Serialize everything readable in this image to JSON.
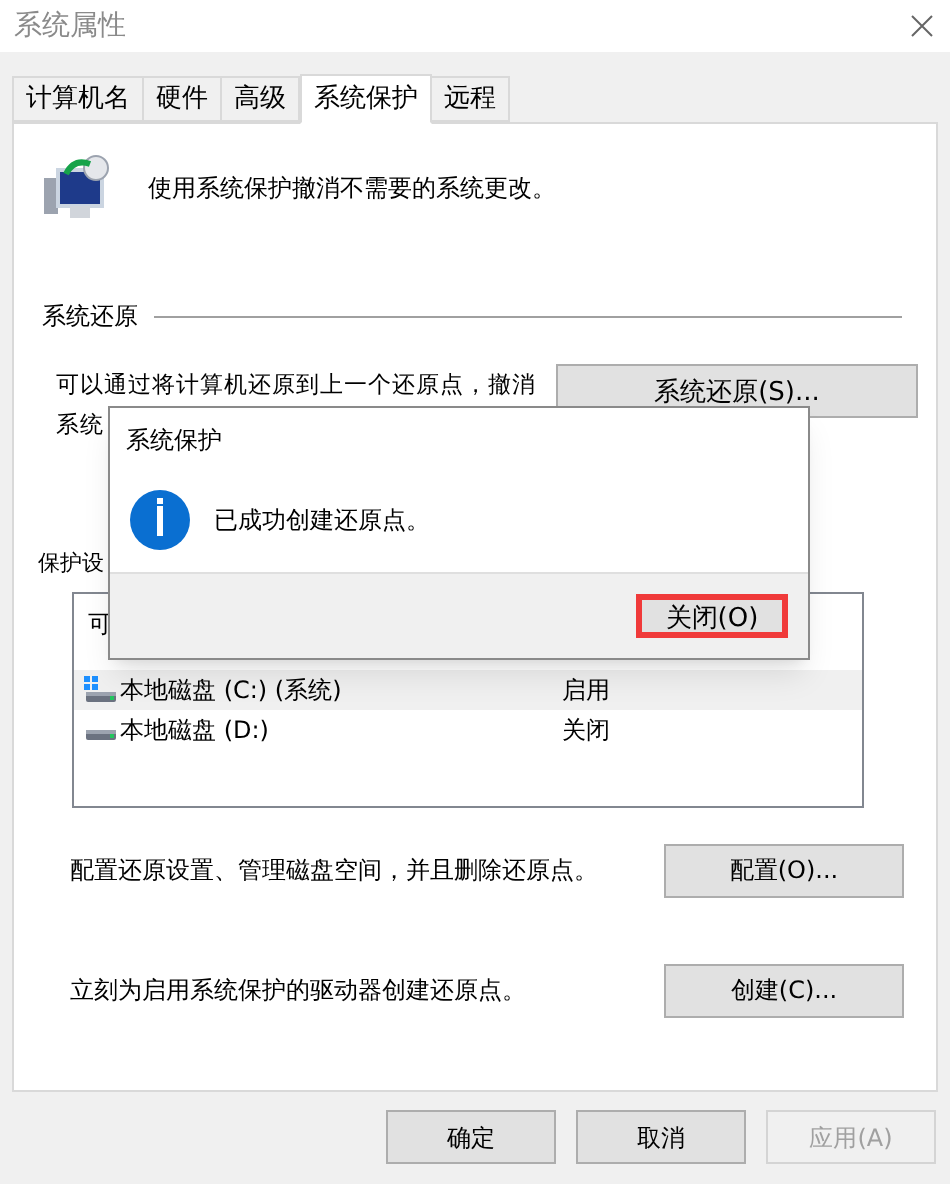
{
  "window": {
    "title": "系统属性"
  },
  "tabs": [
    {
      "label": "计算机名",
      "selected": false
    },
    {
      "label": "硬件",
      "selected": false
    },
    {
      "label": "高级",
      "selected": false
    },
    {
      "label": "系统保护",
      "selected": true
    },
    {
      "label": "远程",
      "selected": false
    }
  ],
  "intro": "使用系统保护撤消不需要的系统更改。",
  "restore_group": {
    "label": "系统还原",
    "description_lines": [
      "可以通过将计算机还原到上一个还原点，撤消",
      "系统"
    ],
    "button": "系统还原(S)..."
  },
  "protection_group": {
    "label": "保护设",
    "columns": [
      "可"
    ],
    "rows": [
      {
        "drive": "本地磁盘 (C:) (系统)",
        "protection": "启用",
        "kind": "system",
        "selected": true
      },
      {
        "drive": "本地磁盘 (D:)",
        "protection": "关闭",
        "kind": "disk",
        "selected": false
      }
    ]
  },
  "configure": {
    "text": "配置还原设置、管理磁盘空间，并且删除还原点。",
    "button": "配置(O)..."
  },
  "create": {
    "text": "立刻为启用系统保护的驱动器创建还原点。",
    "button": "创建(C)..."
  },
  "buttons": [
    {
      "label": "确定",
      "disabled": false
    },
    {
      "label": "取消",
      "disabled": false
    },
    {
      "label": "应用(A)",
      "disabled": true
    }
  ],
  "dialog": {
    "title": "系统保护",
    "message": "已成功创建还原点。",
    "button": {
      "label": "关闭(O)",
      "highlighted": true
    }
  }
}
